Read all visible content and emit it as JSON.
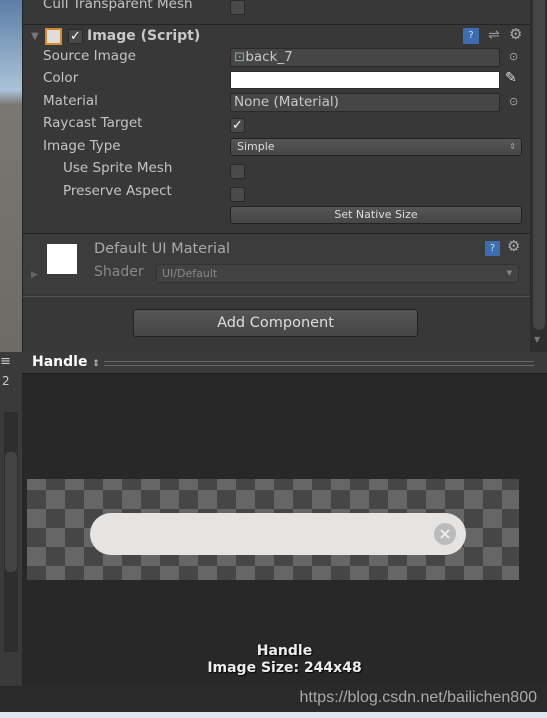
{
  "inspector": {
    "cull_transparent_mesh_label": "Cull Transparent Mesh",
    "component_title": "Image (Script)",
    "component_enabled": true,
    "fields": {
      "source_image_label": "Source Image",
      "source_image_value": "back_7",
      "color_label": "Color",
      "color_value": "#ffffff",
      "material_label": "Material",
      "material_value": "None (Material)",
      "raycast_target_label": "Raycast Target",
      "raycast_target_checked": true,
      "image_type_label": "Image Type",
      "image_type_value": "Simple",
      "use_sprite_mesh_label": "Use Sprite Mesh",
      "preserve_aspect_label": "Preserve Aspect"
    },
    "set_native_size_label": "Set Native Size",
    "material_section": {
      "name": "Default UI Material",
      "shader_label": "Shader",
      "shader_value": "UI/Default"
    },
    "add_component_label": "Add Component"
  },
  "preview": {
    "selector_label": "Handle",
    "name": "Handle",
    "image_size": "Image Size: 244x48"
  },
  "left_panel": {
    "number": "2"
  },
  "watermark": "https://blog.csdn.net/bailichen800"
}
